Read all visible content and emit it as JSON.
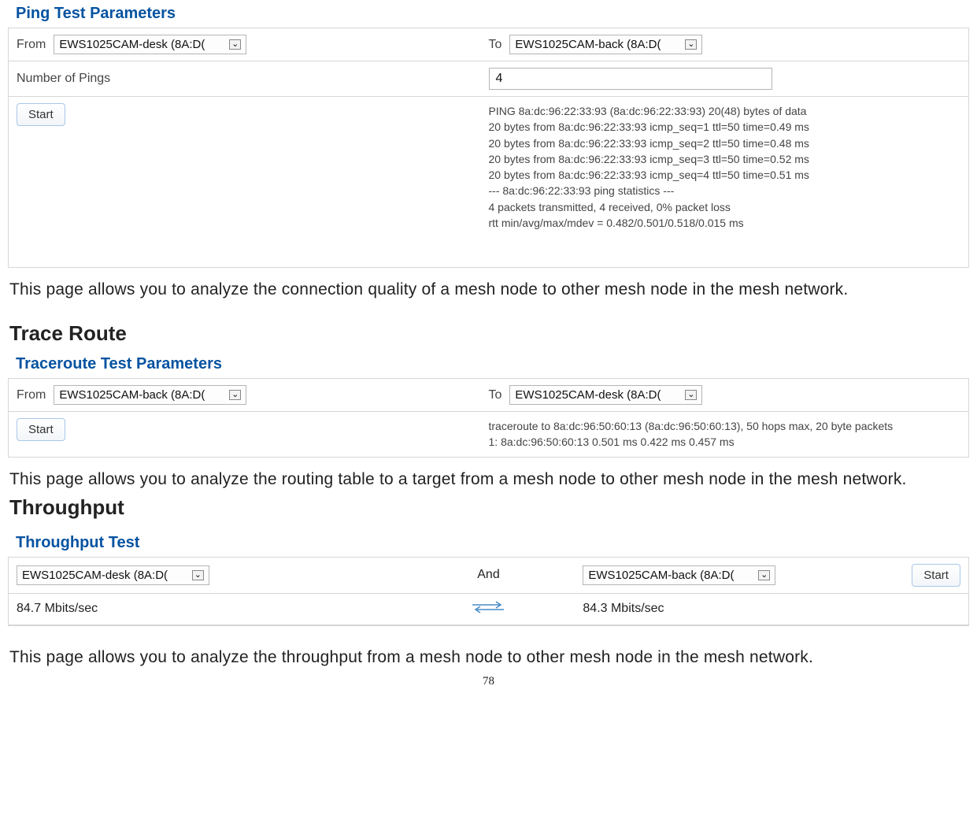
{
  "ping": {
    "heading": "Ping Test Parameters",
    "from_label": "From",
    "to_label": "To",
    "from_value": "EWS1025CAM-desk (8A:D(",
    "to_value": "EWS1025CAM-back (8A:D(",
    "num_pings_label": "Number of Pings",
    "num_pings_value": "4",
    "start_label": "Start",
    "result_lines": [
      "PING 8a:dc:96:22:33:93 (8a:dc:96:22:33:93) 20(48) bytes of data",
      "20 bytes from 8a:dc:96:22:33:93 icmp_seq=1 ttl=50 time=0.49 ms",
      "20 bytes from 8a:dc:96:22:33:93 icmp_seq=2 ttl=50 time=0.48 ms",
      "20 bytes from 8a:dc:96:22:33:93 icmp_seq=3 ttl=50 time=0.52 ms",
      "20 bytes from 8a:dc:96:22:33:93 icmp_seq=4 ttl=50 time=0.51 ms",
      "--- 8a:dc:96:22:33:93 ping statistics ---",
      "4 packets transmitted, 4 received, 0% packet loss",
      "rtt min/avg/max/mdev = 0.482/0.501/0.518/0.015 ms"
    ],
    "description": "This page allows you to analyze the connection quality of a mesh node to other mesh node in the mesh network."
  },
  "trace": {
    "section_title": "Trace Route",
    "heading": "Traceroute Test Parameters",
    "from_label": "From",
    "to_label": "To",
    "from_value": "EWS1025CAM-back (8A:D(",
    "to_value": "EWS1025CAM-desk (8A:D(",
    "start_label": "Start",
    "result_lines": [
      "traceroute to 8a:dc:96:50:60:13 (8a:dc:96:50:60:13), 50 hops max, 20 byte packets",
      " 1: 8a:dc:96:50:60:13  0.501 ms  0.422 ms  0.457 ms"
    ],
    "description": "This page allows you to analyze the routing table to a target from a mesh node to other mesh node in the mesh network."
  },
  "throughput": {
    "section_title": "Throughput",
    "heading": "Throughput Test",
    "left_value": "EWS1025CAM-desk (8A:D(",
    "and_label": "And",
    "right_value": "EWS1025CAM-back (8A:D(",
    "start_label": "Start",
    "left_speed": "84.7 Mbits/sec",
    "right_speed": "84.3 Mbits/sec",
    "description": "This page allows you to analyze the throughput from a mesh node to other mesh node in the mesh network."
  },
  "page_number": "78"
}
